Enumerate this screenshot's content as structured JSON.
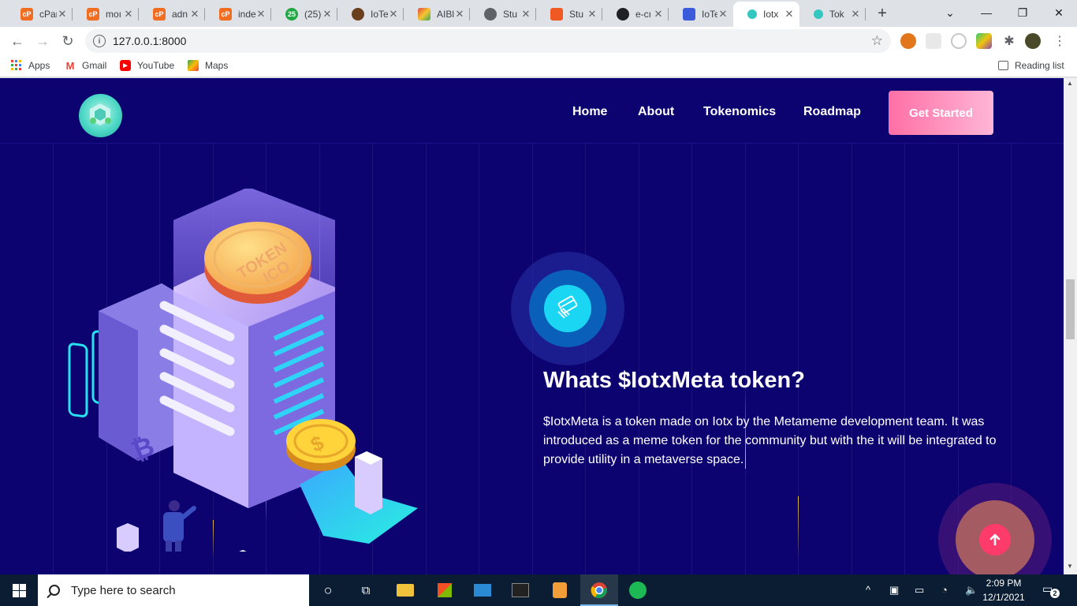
{
  "browser": {
    "tabs": [
      {
        "label": "cPar",
        "fav": "cP",
        "color": "#f06d22"
      },
      {
        "label": "moı",
        "fav": "cP",
        "color": "#f06d22"
      },
      {
        "label": "adn",
        "fav": "cP",
        "color": "#f06d22"
      },
      {
        "label": "inde",
        "fav": "cP",
        "color": "#f06d22"
      },
      {
        "label": "(25)",
        "fav": "25",
        "color": "#1fa843"
      },
      {
        "label": "IoTe",
        "fav": "",
        "color": "#6b3f1d"
      },
      {
        "label": "AIBl",
        "fav": "",
        "color": "#e0453e"
      },
      {
        "label": "Stu",
        "fav": "",
        "color": "#5f6368"
      },
      {
        "label": "Stu",
        "fav": "",
        "color": "#f05a22"
      },
      {
        "label": "e-cı",
        "fav": "",
        "color": "#202124"
      },
      {
        "label": "IoTe",
        "fav": "",
        "color": "#3b5bdb"
      },
      {
        "label": "Iotx",
        "fav": "",
        "color": "#34c7c0"
      },
      {
        "label": "Tok",
        "fav": "",
        "color": "#34c7c0"
      }
    ],
    "url": "127.0.0.1:8000",
    "bookmarks": [
      {
        "label": "Apps"
      },
      {
        "label": "Gmail"
      },
      {
        "label": "YouTube"
      },
      {
        "label": "Maps"
      }
    ],
    "reading_list": "Reading list"
  },
  "site": {
    "nav": [
      {
        "label": "Home"
      },
      {
        "label": "About"
      },
      {
        "label": "Tokenomics"
      },
      {
        "label": "Roadmap"
      }
    ],
    "cta": "Get Started",
    "heading": "Whats $IotxMeta token?",
    "paragraph": "$IotxMeta is a token made on Iotx by the Metameme development team. It was introduced as a meme token for the community but with the it will be integrated to provide utility in a metaverse space.",
    "illustration": {
      "coin_text_1": "TOKEN",
      "coin_text_2": "ICO",
      "coin2_text": "$"
    }
  },
  "taskbar": {
    "search_placeholder": "Type here to search",
    "time": "2:09 PM",
    "date": "12/1/2021",
    "notifications": "2"
  }
}
